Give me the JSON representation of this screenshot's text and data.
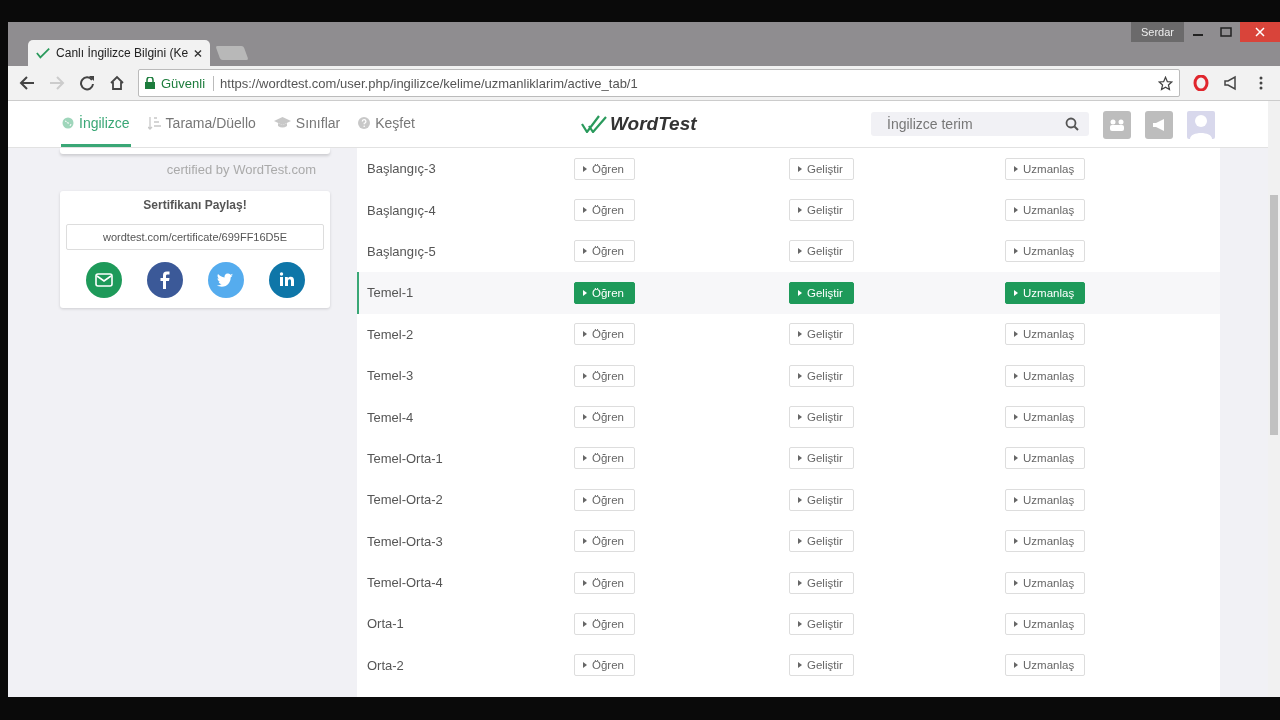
{
  "browser": {
    "tab_title": "Canlı İngilizce Bilgini (Ke",
    "user_name": "Serdar",
    "security_label": "Güvenli",
    "url": "https://wordtest.com/user.php/ingilizce/kelime/uzmanliklarim/active_tab/1"
  },
  "nav": {
    "items": [
      {
        "label": "İngilizce",
        "selected": true,
        "kind": "globe"
      },
      {
        "label": "Tarama/Düello",
        "selected": false,
        "kind": "list"
      },
      {
        "label": "Sınıflar",
        "selected": false,
        "kind": "cap"
      },
      {
        "label": "Keşfet",
        "selected": false,
        "kind": "help"
      }
    ],
    "logo": "WordTest",
    "search_placeholder": "İngilizce terim"
  },
  "sidebar": {
    "certified_text": "certified by WordTest.com",
    "share_title": "Sertifikanı Paylaş!",
    "certificate_url": "wordtest.com/certificate/699FF16D5E",
    "share_buttons": [
      {
        "kind": "email",
        "color": "#1e9a5a"
      },
      {
        "kind": "facebook",
        "color": "#3b5998"
      },
      {
        "kind": "twitter",
        "color": "#55acee"
      },
      {
        "kind": "linkedin",
        "color": "#0e76a8"
      }
    ]
  },
  "levels": [
    {
      "name": "Başlangıç-3",
      "selected": false,
      "buttons": [
        "Öğren",
        "Geliştir",
        "Uzmanlaş"
      ]
    },
    {
      "name": "Başlangıç-4",
      "selected": false,
      "buttons": [
        "Öğren",
        "Geliştir",
        "Uzmanlaş"
      ]
    },
    {
      "name": "Başlangıç-5",
      "selected": false,
      "buttons": [
        "Öğren",
        "Geliştir",
        "Uzmanlaş"
      ]
    },
    {
      "name": "Temel-1",
      "selected": true,
      "buttons": [
        "Öğren",
        "Geliştir",
        "Uzmanlaş"
      ]
    },
    {
      "name": "Temel-2",
      "selected": false,
      "buttons": [
        "Öğren",
        "Geliştir",
        "Uzmanlaş"
      ]
    },
    {
      "name": "Temel-3",
      "selected": false,
      "buttons": [
        "Öğren",
        "Geliştir",
        "Uzmanlaş"
      ]
    },
    {
      "name": "Temel-4",
      "selected": false,
      "buttons": [
        "Öğren",
        "Geliştir",
        "Uzmanlaş"
      ]
    },
    {
      "name": "Temel-Orta-1",
      "selected": false,
      "buttons": [
        "Öğren",
        "Geliştir",
        "Uzmanlaş"
      ]
    },
    {
      "name": "Temel-Orta-2",
      "selected": false,
      "buttons": [
        "Öğren",
        "Geliştir",
        "Uzmanlaş"
      ]
    },
    {
      "name": "Temel-Orta-3",
      "selected": false,
      "buttons": [
        "Öğren",
        "Geliştir",
        "Uzmanlaş"
      ]
    },
    {
      "name": "Temel-Orta-4",
      "selected": false,
      "buttons": [
        "Öğren",
        "Geliştir",
        "Uzmanlaş"
      ]
    },
    {
      "name": "Orta-1",
      "selected": false,
      "buttons": [
        "Öğren",
        "Geliştir",
        "Uzmanlaş"
      ]
    },
    {
      "name": "Orta-2",
      "selected": false,
      "buttons": [
        "Öğren",
        "Geliştir",
        "Uzmanlaş"
      ]
    }
  ]
}
